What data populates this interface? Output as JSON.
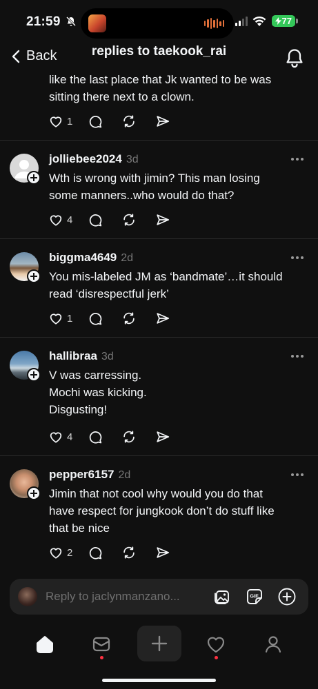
{
  "status_bar": {
    "time": "21:59",
    "battery": "77",
    "colors": {
      "battery": "#34c759",
      "wave": "#e2703a"
    },
    "icons": [
      "bell-slash-icon",
      "album-art-icon",
      "audio-wave-icon",
      "cell-signal-icon",
      "wifi-icon",
      "battery-icon"
    ]
  },
  "header": {
    "back_label": "Back",
    "title": "replies to taekook_rai"
  },
  "replies": [
    {
      "username": "",
      "time": "",
      "lines": [
        "like the last place that Jk wanted to be was",
        "sitting there next to a clown."
      ],
      "likes": "1",
      "replies_count": "",
      "reposts": "",
      "shares": ""
    },
    {
      "username": "jolliebee2024",
      "time": "3d",
      "lines": [
        "Wth is wrong with jimin? This man losing",
        "some manners..who would do that?"
      ],
      "likes": "4",
      "replies_count": "",
      "reposts": "",
      "shares": ""
    },
    {
      "username": "biggma4649",
      "time": "2d",
      "lines": [
        "You mis-labeled JM as ‘bandmate’…it should",
        "read ‘disrespectful jerk’"
      ],
      "likes": "1",
      "replies_count": "",
      "reposts": "",
      "shares": ""
    },
    {
      "username": "hallibraa",
      "time": "3d",
      "lines": [
        "V was carressing.",
        "Mochi was kicking.",
        "Disgusting!"
      ],
      "likes": "4",
      "replies_count": "",
      "reposts": "",
      "shares": ""
    },
    {
      "username": "pepper6157",
      "time": "2d",
      "lines": [
        "Jimin that not cool why would you do that",
        "have respect for jungkook don’t do stuff like",
        "that be nice"
      ],
      "likes": "2",
      "replies_count": "",
      "reposts": "",
      "shares": ""
    }
  ],
  "composer": {
    "placeholder": "Reply to jaclynmanzano...",
    "value": ""
  },
  "tabbar": {
    "items": [
      "home-icon",
      "inbox-icon",
      "create-icon",
      "activity-heart-icon",
      "profile-icon"
    ],
    "notification_dot_color": "#ff3040"
  }
}
